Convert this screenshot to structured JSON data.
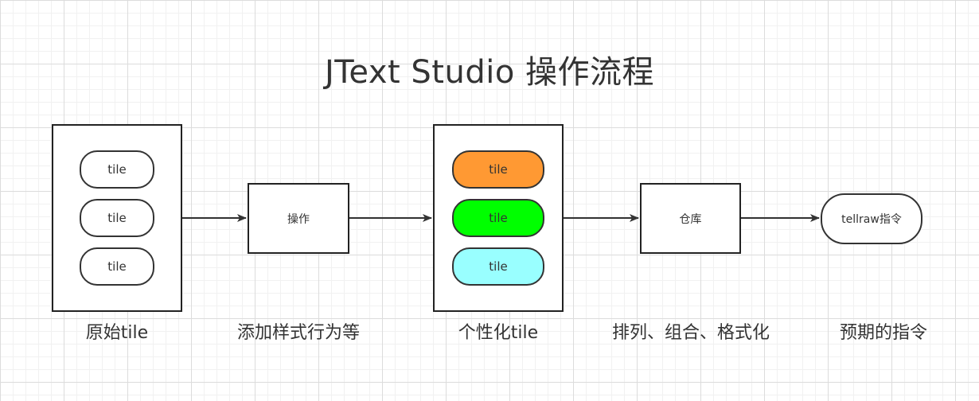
{
  "title": "JText Studio 操作流程",
  "groups": {
    "original": {
      "tiles": [
        "tile",
        "tile",
        "tile"
      ],
      "caption": "原始tile"
    },
    "custom": {
      "tiles": [
        "tile",
        "tile",
        "tile"
      ],
      "caption": "个性化tile"
    }
  },
  "steps": {
    "operate": {
      "label": "操作",
      "caption": "添加样式行为等"
    },
    "repository": {
      "label": "仓库",
      "caption": "排列、组合、格式化"
    },
    "output": {
      "label": "tellraw指令",
      "caption": "预期的指令"
    }
  },
  "colors": {
    "tile_orange": "#ff9933",
    "tile_green": "#00ff00",
    "tile_cyan": "#99ffff",
    "stroke": "#333333"
  }
}
